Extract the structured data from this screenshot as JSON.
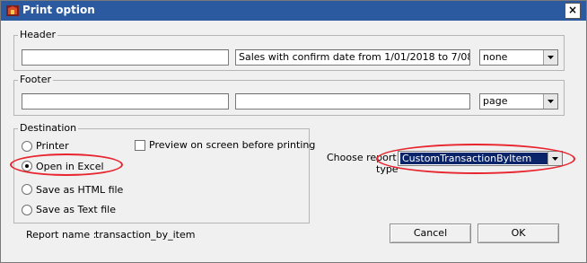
{
  "window": {
    "title": "Print option",
    "close_label": "×"
  },
  "header": {
    "legend": "Header",
    "left_value": "",
    "center_value": "Sales with confirm date from 1/01/2018 to 7/08/201",
    "right_select": "none"
  },
  "footer": {
    "legend": "Footer",
    "left_value": "",
    "center_value": "",
    "right_select": "page"
  },
  "destination": {
    "legend": "Destination",
    "options": [
      {
        "label": "Printer",
        "selected": false
      },
      {
        "label": "Open in Excel",
        "selected": true
      },
      {
        "label": "Save as HTML file",
        "selected": false
      },
      {
        "label": "Save as Text file",
        "selected": false
      }
    ],
    "preview_label": "Preview on screen before printing",
    "preview_checked": false
  },
  "report": {
    "choose_label_line1": "Choose report",
    "choose_label_line2": "type",
    "selected_type": "CustomTransactionByItem",
    "name_label": "Report name :",
    "name_value": "transaction_by_item"
  },
  "buttons": {
    "cancel": "Cancel",
    "ok": "OK"
  },
  "colors": {
    "titlebar": "#2c5aa0",
    "selection": "#0a246a",
    "annotation": "#e8242e"
  }
}
